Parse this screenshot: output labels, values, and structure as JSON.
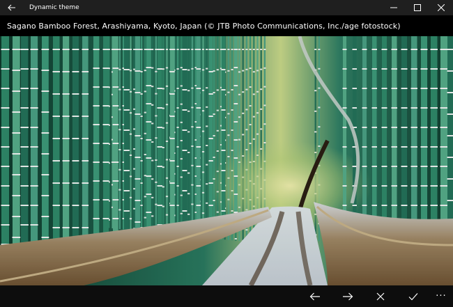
{
  "window": {
    "title": "Dynamic theme",
    "back_icon": "back-arrow-icon",
    "controls": [
      "minimize-icon",
      "maximize-icon",
      "close-icon"
    ]
  },
  "caption": {
    "text": "Sagano Bamboo Forest, Arashiyama, Kyoto, Japan (© JTB Photo Communications, Inc./age fotostock)"
  },
  "appbar": {
    "buttons": [
      "previous-arrow-icon",
      "next-arrow-icon",
      "cancel-x-icon",
      "accept-check-icon"
    ],
    "more_label": "···"
  },
  "colors": {
    "titlebar_bg": "#1f1f1f",
    "caption_bg": "#000000",
    "appbar_bg": "#0d0d0d",
    "bamboo_green": "#2f8a6a",
    "snow": "#eef2f4"
  }
}
